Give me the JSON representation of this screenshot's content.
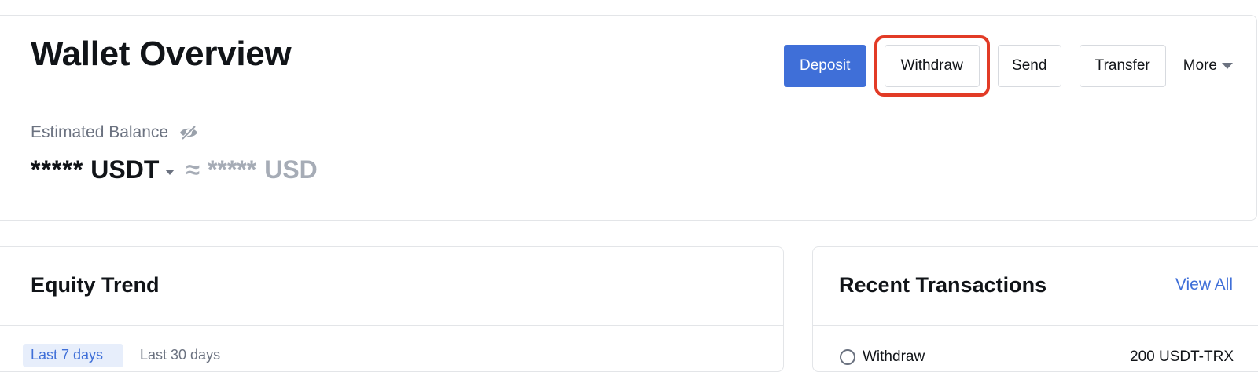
{
  "overview": {
    "title": "Wallet Overview",
    "actions": {
      "deposit": "Deposit",
      "withdraw": "Withdraw",
      "send": "Send",
      "transfer": "Transfer",
      "more": "More"
    },
    "balance": {
      "label": "Estimated Balance",
      "masked_amount": "*****",
      "currency": "USDT",
      "approx_symbol": "≈",
      "masked_fiat": "*****",
      "fiat_currency": "USD"
    }
  },
  "equity": {
    "title": "Equity Trend",
    "tabs": [
      "Last 7 days",
      "Last 30 days"
    ]
  },
  "transactions": {
    "title": "Recent Transactions",
    "view_all": "View All",
    "rows": [
      {
        "type": "Withdraw",
        "amount": "200 USDT-TRX"
      }
    ]
  },
  "colors": {
    "primary": "#3f6fd8",
    "highlight": "#e23b26",
    "muted": "#a6acb6"
  },
  "icons": {
    "balance_visibility": "eye-off-icon",
    "more_caret": "caret-down-icon",
    "currency_caret": "caret-down-icon",
    "transaction_status": "clock-icon"
  }
}
